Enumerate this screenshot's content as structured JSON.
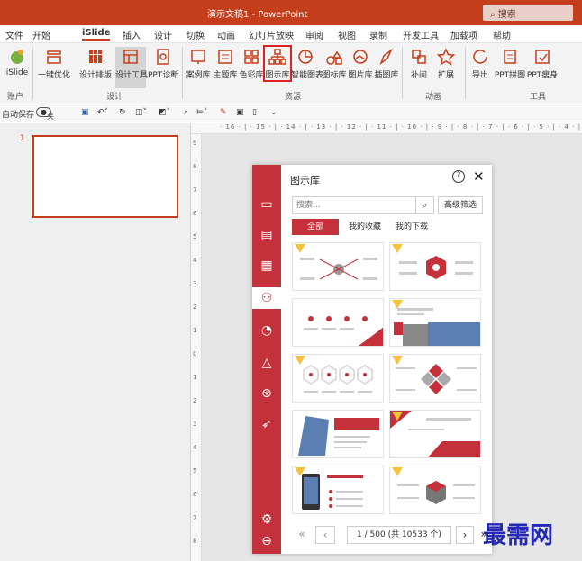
{
  "window": {
    "title": "演示文稿1 - PowerPoint",
    "search": "搜索"
  },
  "menu": [
    "文件",
    "开始",
    "iSlide",
    "插入",
    "设计",
    "切换",
    "动画",
    "幻灯片放映",
    "审阅",
    "视图",
    "录制",
    "开发工具",
    "加载项",
    "帮助"
  ],
  "ribbon": {
    "buttons": [
      {
        "label": "iSlide",
        "icon": "islide-logo-icon"
      },
      {
        "label": "一键优化",
        "icon": "optimize-icon"
      },
      {
        "label": "设计排版",
        "icon": "layout-grid-icon"
      },
      {
        "label": "设计工具",
        "icon": "design-tool-icon"
      },
      {
        "label": "PPT诊断",
        "icon": "diagnose-icon"
      },
      {
        "label": "案例库",
        "icon": "case-library-icon"
      },
      {
        "label": "主题库",
        "icon": "theme-library-icon"
      },
      {
        "label": "色彩库",
        "icon": "color-library-icon"
      },
      {
        "label": "图示库",
        "icon": "diagram-library-icon"
      },
      {
        "label": "智能图表",
        "icon": "smart-chart-icon"
      },
      {
        "label": "图标库",
        "icon": "icon-library-icon"
      },
      {
        "label": "图片库",
        "icon": "picture-library-icon"
      },
      {
        "label": "插图库",
        "icon": "illustration-library-icon"
      },
      {
        "label": "补间",
        "icon": "tween-icon"
      },
      {
        "label": "扩展",
        "icon": "extend-icon"
      },
      {
        "label": "导出",
        "icon": "export-icon"
      },
      {
        "label": "PPT拼图",
        "icon": "ppt-puzzle-icon"
      },
      {
        "label": "PPT瘦身",
        "icon": "ppt-slim-icon"
      }
    ],
    "groups": [
      "账户",
      "设计",
      "资源",
      "动画",
      "工具"
    ]
  },
  "qat": {
    "autosave_label": "自动保存",
    "autosave_state": "关"
  },
  "slides": {
    "current_number": "1"
  },
  "ruler": {
    "horizontal": "· 16 · | · 15 · | · 14 · | · 13 · | · 12 · | · 11 · | · 10 · | · 9 · | · 8 · | · 7 · | · 6 · | · 5 · | · 4 · | · 3 · | · 2 · | · 1",
    "vertical": [
      "9",
      "8",
      "7",
      "6",
      "5",
      "4",
      "3",
      "2",
      "1",
      "0",
      "1",
      "2",
      "3",
      "4",
      "5",
      "6",
      "7",
      "8"
    ]
  },
  "panel": {
    "title": "图示库",
    "search_placeholder": "搜索...",
    "advanced_filter": "高级筛选",
    "tabs": [
      "全部",
      "我的收藏",
      "我的下载"
    ],
    "active_tab": 0,
    "pager": {
      "text": "1 / 500 (共 10533 个)"
    },
    "side_icons": [
      "case-icon",
      "theme-icon",
      "layout-icon",
      "diagram-icon",
      "chart-icon",
      "shapes-icon",
      "palette-icon",
      "rocket-icon",
      "settings-icon",
      "back-icon"
    ],
    "accent": "#c5313a",
    "badge_color": "#f5c33b"
  },
  "watermark": "最需网"
}
